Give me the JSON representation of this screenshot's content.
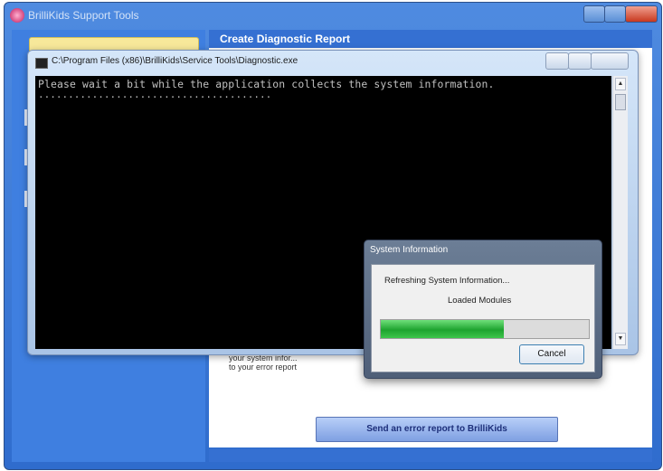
{
  "main_window": {
    "title": "BrilliKids Support Tools",
    "content_header": "Create Diagnostic Report",
    "partial_text": "your system infor...",
    "partial_text_2": "to your error report",
    "send_button": "Send an error report to BrilliKids"
  },
  "console": {
    "title": "C:\\Program Files (x86)\\BrilliKids\\Service Tools\\Diagnostic.exe",
    "line_1": "Please wait a bit while the application collects the system information.",
    "line_2": "......................................."
  },
  "sysinfo_dialog": {
    "title": "System Information",
    "status": "Refreshing System Information...",
    "detail": "Loaded Modules",
    "progress": 0.59,
    "cancel_label": "Cancel"
  },
  "colors": {
    "progress_fill": "#1ea32f",
    "window_blue": "#3570d2",
    "console_background": "#000000"
  },
  "icons": [
    "app-icon",
    "console-icon",
    "minimize-icon",
    "maximize-icon",
    "close-icon",
    "scroll-up-icon",
    "scroll-down-icon"
  ]
}
